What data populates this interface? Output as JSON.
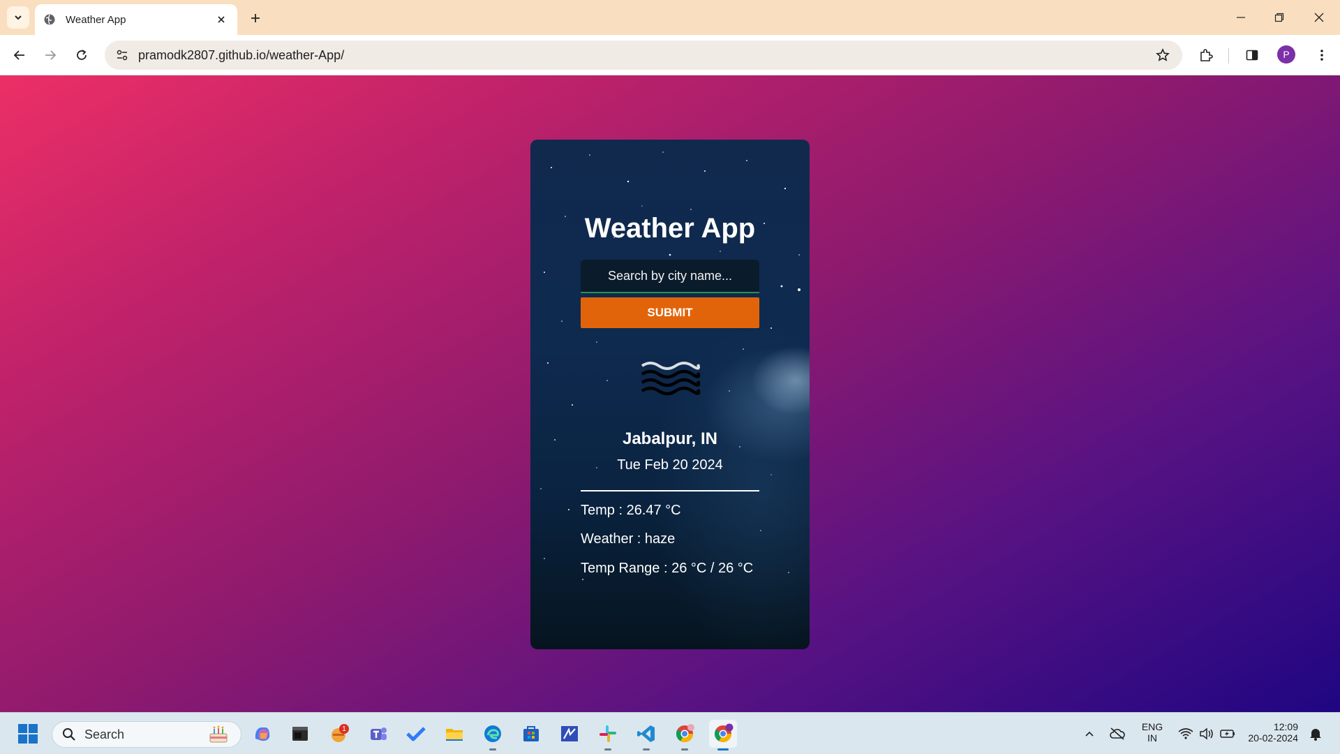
{
  "browser": {
    "tab_title": "Weather App",
    "url": "pramodk2807.github.io/weather-App/",
    "profile_initial": "P"
  },
  "app": {
    "title": "Weather App",
    "search_placeholder": "Search by city name...",
    "submit_label": "SUBMIT",
    "weather_icon": "haze-icon",
    "city": "Jabalpur, IN",
    "date": "Tue Feb 20 2024",
    "temp": "Temp : 26.47 °C",
    "weather": "Weather : haze",
    "temp_range": "Temp Range : 26 °C / 26 °C"
  },
  "taskbar": {
    "search_label": "Search",
    "notification_badge": "1",
    "apps": [
      "copilot-icon",
      "terminal-icon",
      "notification-app-icon",
      "teams-icon",
      "todo-icon",
      "file-explorer-icon",
      "edge-icon",
      "store-icon",
      "powerautomate-icon",
      "slack-icon",
      "vscode-icon",
      "chrome-icon",
      "chrome-profile-icon"
    ],
    "language": "ENG",
    "region": "IN",
    "time": "12:09",
    "date": "20-02-2024"
  },
  "colors": {
    "tabstrip": "#f9dfbf",
    "submit": "#e2640a",
    "bg_start": "#ec2f66",
    "bg_end": "#1f0682"
  }
}
